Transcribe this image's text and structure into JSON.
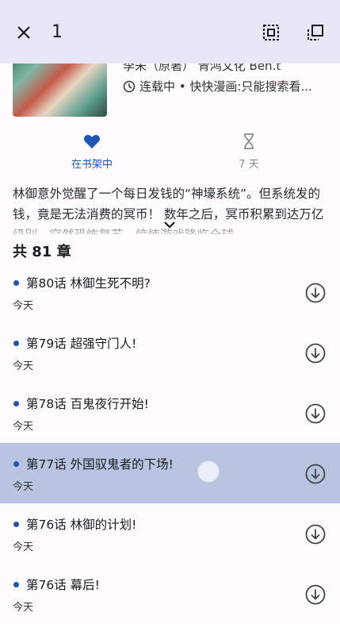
{
  "header": {
    "selected_count": "1",
    "close_icon": "close-icon",
    "select_all_icon": "select-all-icon",
    "invert_select_icon": "flip-selection-icon"
  },
  "manga": {
    "author": "李未（原著） 青鸿文化 Ben.t",
    "status": "连载中 • 快快漫画:只能搜索看...",
    "description": "林御意外觉醒了一个每日发钱的“神壕系统”。但系统发的钱，竟是无法消费的冥币！ 数年之后，冥币积累到达万亿级别，突然恐怖复苏，惊悚游戏降临全球..."
  },
  "actions": {
    "library_label": "在书架中",
    "interval_label": "7 天"
  },
  "chapters": {
    "count_label": "共 81 章",
    "items": [
      {
        "title": "第80话 林御生死不明?",
        "date": "今天"
      },
      {
        "title": "第79话 超强守门人!",
        "date": "今天"
      },
      {
        "title": "第78话 百鬼夜行开始!",
        "date": "今天"
      },
      {
        "title": "第77话 外国驭鬼者的下场!",
        "date": "今天"
      },
      {
        "title": "第76话 林御的计划!",
        "date": "今天"
      },
      {
        "title": "第76话 幕后!",
        "date": "今天"
      }
    ]
  },
  "colors": {
    "accent": "#1f55b4",
    "selected_row": "#b9c5e0",
    "topbar": "#e6e8f6"
  }
}
